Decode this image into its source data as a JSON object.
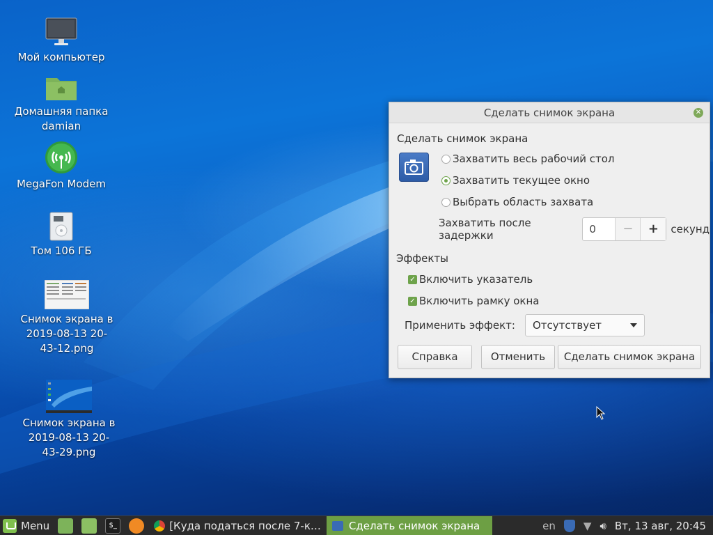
{
  "desktop": {
    "icons": [
      {
        "label": "Мой компьютер",
        "icon": "computer-icon"
      },
      {
        "label": "Домашняя папка\ndamian",
        "icon": "home-folder-icon"
      },
      {
        "label": "MegaFon Modem",
        "icon": "modem-icon"
      },
      {
        "label": "Том 106 ГБ",
        "icon": "drive-icon"
      },
      {
        "label": "Снимок экрана в\n2019-08-13 20-\n43-12.png",
        "icon": "image-thumbnail-icon"
      },
      {
        "label": "Снимок экрана в\n2019-08-13 20-\n43-29.png",
        "icon": "image-thumbnail-icon"
      }
    ]
  },
  "dialog": {
    "title": "Сделать снимок экрана",
    "capture_heading": "Сделать снимок экрана",
    "options": [
      {
        "label": "Захватить весь рабочий стол",
        "selected": false
      },
      {
        "label": "Захватить текущее окно",
        "selected": true
      },
      {
        "label": "Выбрать область захвата",
        "selected": false
      }
    ],
    "delay_label": "Захватить после задержки",
    "delay_value": "0",
    "delay_unit": "секунд",
    "effects_heading": "Эффекты",
    "include_pointer": "Включить указатель",
    "include_border": "Включить рамку окна",
    "apply_effect_label": "Применить эффект:",
    "effect_value": "Отсутствует",
    "help_button": "Справка",
    "cancel_button": "Отменить",
    "take_button": "Сделать снимок экрана",
    "accent_color": "#6ea34b"
  },
  "taskbar": {
    "menu_label": "Menu",
    "tasks": [
      {
        "label": "[Куда податься после 7-к…",
        "active": false,
        "icon": "chrome-icon"
      },
      {
        "label": "Сделать снимок экрана",
        "active": true,
        "icon": "screenshot-icon"
      }
    ],
    "keyboard_layout": "en",
    "clock": "Вт, 13 авг, 20:45",
    "accent_color": "#6d9f44"
  }
}
